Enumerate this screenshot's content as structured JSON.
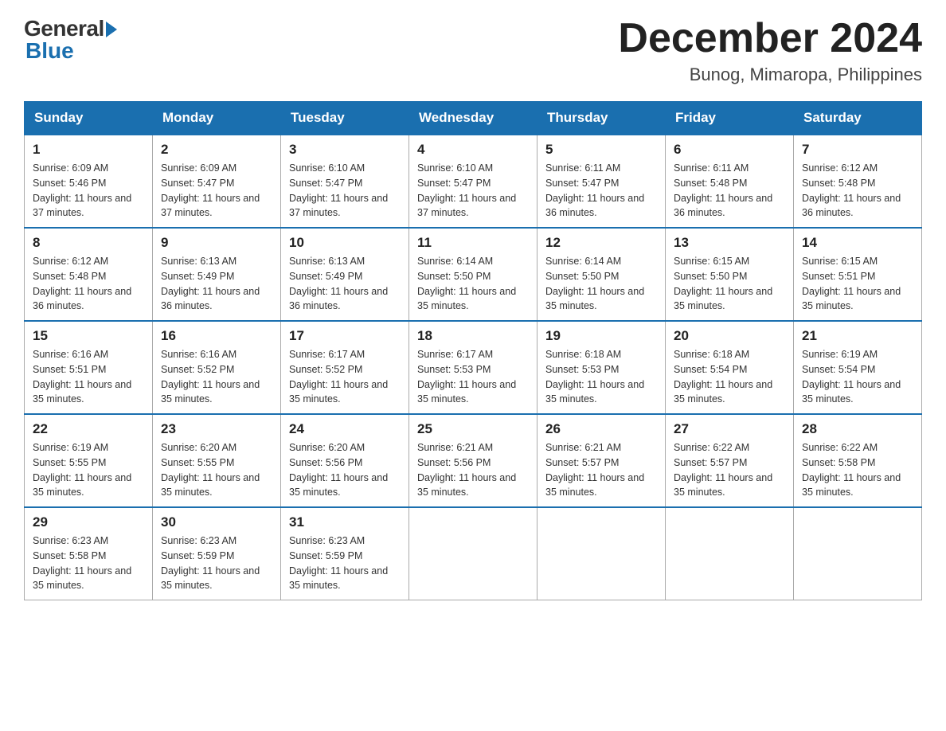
{
  "logo": {
    "general": "General",
    "blue": "Blue"
  },
  "title": "December 2024",
  "location": "Bunog, Mimaropa, Philippines",
  "days_of_week": [
    "Sunday",
    "Monday",
    "Tuesday",
    "Wednesday",
    "Thursday",
    "Friday",
    "Saturday"
  ],
  "weeks": [
    [
      {
        "day": "1",
        "sunrise": "6:09 AM",
        "sunset": "5:46 PM",
        "daylight": "11 hours and 37 minutes."
      },
      {
        "day": "2",
        "sunrise": "6:09 AM",
        "sunset": "5:47 PM",
        "daylight": "11 hours and 37 minutes."
      },
      {
        "day": "3",
        "sunrise": "6:10 AM",
        "sunset": "5:47 PM",
        "daylight": "11 hours and 37 minutes."
      },
      {
        "day": "4",
        "sunrise": "6:10 AM",
        "sunset": "5:47 PM",
        "daylight": "11 hours and 37 minutes."
      },
      {
        "day": "5",
        "sunrise": "6:11 AM",
        "sunset": "5:47 PM",
        "daylight": "11 hours and 36 minutes."
      },
      {
        "day": "6",
        "sunrise": "6:11 AM",
        "sunset": "5:48 PM",
        "daylight": "11 hours and 36 minutes."
      },
      {
        "day": "7",
        "sunrise": "6:12 AM",
        "sunset": "5:48 PM",
        "daylight": "11 hours and 36 minutes."
      }
    ],
    [
      {
        "day": "8",
        "sunrise": "6:12 AM",
        "sunset": "5:48 PM",
        "daylight": "11 hours and 36 minutes."
      },
      {
        "day": "9",
        "sunrise": "6:13 AM",
        "sunset": "5:49 PM",
        "daylight": "11 hours and 36 minutes."
      },
      {
        "day": "10",
        "sunrise": "6:13 AM",
        "sunset": "5:49 PM",
        "daylight": "11 hours and 36 minutes."
      },
      {
        "day": "11",
        "sunrise": "6:14 AM",
        "sunset": "5:50 PM",
        "daylight": "11 hours and 35 minutes."
      },
      {
        "day": "12",
        "sunrise": "6:14 AM",
        "sunset": "5:50 PM",
        "daylight": "11 hours and 35 minutes."
      },
      {
        "day": "13",
        "sunrise": "6:15 AM",
        "sunset": "5:50 PM",
        "daylight": "11 hours and 35 minutes."
      },
      {
        "day": "14",
        "sunrise": "6:15 AM",
        "sunset": "5:51 PM",
        "daylight": "11 hours and 35 minutes."
      }
    ],
    [
      {
        "day": "15",
        "sunrise": "6:16 AM",
        "sunset": "5:51 PM",
        "daylight": "11 hours and 35 minutes."
      },
      {
        "day": "16",
        "sunrise": "6:16 AM",
        "sunset": "5:52 PM",
        "daylight": "11 hours and 35 minutes."
      },
      {
        "day": "17",
        "sunrise": "6:17 AM",
        "sunset": "5:52 PM",
        "daylight": "11 hours and 35 minutes."
      },
      {
        "day": "18",
        "sunrise": "6:17 AM",
        "sunset": "5:53 PM",
        "daylight": "11 hours and 35 minutes."
      },
      {
        "day": "19",
        "sunrise": "6:18 AM",
        "sunset": "5:53 PM",
        "daylight": "11 hours and 35 minutes."
      },
      {
        "day": "20",
        "sunrise": "6:18 AM",
        "sunset": "5:54 PM",
        "daylight": "11 hours and 35 minutes."
      },
      {
        "day": "21",
        "sunrise": "6:19 AM",
        "sunset": "5:54 PM",
        "daylight": "11 hours and 35 minutes."
      }
    ],
    [
      {
        "day": "22",
        "sunrise": "6:19 AM",
        "sunset": "5:55 PM",
        "daylight": "11 hours and 35 minutes."
      },
      {
        "day": "23",
        "sunrise": "6:20 AM",
        "sunset": "5:55 PM",
        "daylight": "11 hours and 35 minutes."
      },
      {
        "day": "24",
        "sunrise": "6:20 AM",
        "sunset": "5:56 PM",
        "daylight": "11 hours and 35 minutes."
      },
      {
        "day": "25",
        "sunrise": "6:21 AM",
        "sunset": "5:56 PM",
        "daylight": "11 hours and 35 minutes."
      },
      {
        "day": "26",
        "sunrise": "6:21 AM",
        "sunset": "5:57 PM",
        "daylight": "11 hours and 35 minutes."
      },
      {
        "day": "27",
        "sunrise": "6:22 AM",
        "sunset": "5:57 PM",
        "daylight": "11 hours and 35 minutes."
      },
      {
        "day": "28",
        "sunrise": "6:22 AM",
        "sunset": "5:58 PM",
        "daylight": "11 hours and 35 minutes."
      }
    ],
    [
      {
        "day": "29",
        "sunrise": "6:23 AM",
        "sunset": "5:58 PM",
        "daylight": "11 hours and 35 minutes."
      },
      {
        "day": "30",
        "sunrise": "6:23 AM",
        "sunset": "5:59 PM",
        "daylight": "11 hours and 35 minutes."
      },
      {
        "day": "31",
        "sunrise": "6:23 AM",
        "sunset": "5:59 PM",
        "daylight": "11 hours and 35 minutes."
      },
      null,
      null,
      null,
      null
    ]
  ]
}
